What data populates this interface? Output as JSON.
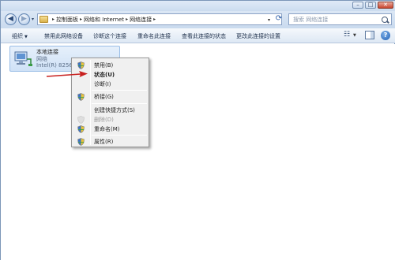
{
  "window": {
    "minimize_glyph": "–",
    "maximize_glyph": "□",
    "close_glyph": "✕"
  },
  "nav": {
    "back_glyph": "◀",
    "forward_glyph": "▶",
    "breadcrumbs": [
      "控制面板",
      "网络和 Internet",
      "网络连接"
    ],
    "separator": "▸",
    "search_placeholder": "搜索 网络连接"
  },
  "commands": [
    {
      "label": "组织",
      "has_dropdown": true
    },
    {
      "label": "禁用此网络设备"
    },
    {
      "label": "诊断这个连接"
    },
    {
      "label": "重命名此连接"
    },
    {
      "label": "查看此连接的状态"
    },
    {
      "label": "更改此连接的设置"
    }
  ],
  "connection": {
    "name": "本地连接",
    "status": "网络",
    "device": "Intel(R) 82566DC"
  },
  "context_menu": [
    {
      "label": "禁用(B)",
      "icon": "shield-icon",
      "disabled": false,
      "bold": false
    },
    {
      "label": "状态(U)",
      "icon": "",
      "disabled": false,
      "bold": true
    },
    {
      "label": "诊断(I)",
      "icon": "",
      "disabled": false,
      "bold": false
    },
    {
      "separator": true
    },
    {
      "label": "桥接(G)",
      "icon": "shield-icon",
      "disabled": false,
      "bold": false
    },
    {
      "separator": true
    },
    {
      "label": "创建快捷方式(S)",
      "icon": "",
      "disabled": false,
      "bold": false
    },
    {
      "label": "删除(D)",
      "icon": "shield-icon",
      "disabled": true,
      "bold": false
    },
    {
      "label": "重命名(M)",
      "icon": "shield-icon",
      "disabled": false,
      "bold": false
    },
    {
      "separator": true
    },
    {
      "label": "属性(R)",
      "icon": "shield-icon",
      "disabled": false,
      "bold": false
    }
  ],
  "colors": {
    "accent": "#cfe1f6",
    "annotation_arrow": "#c8201e",
    "menu_background": "#f0f0f0"
  }
}
